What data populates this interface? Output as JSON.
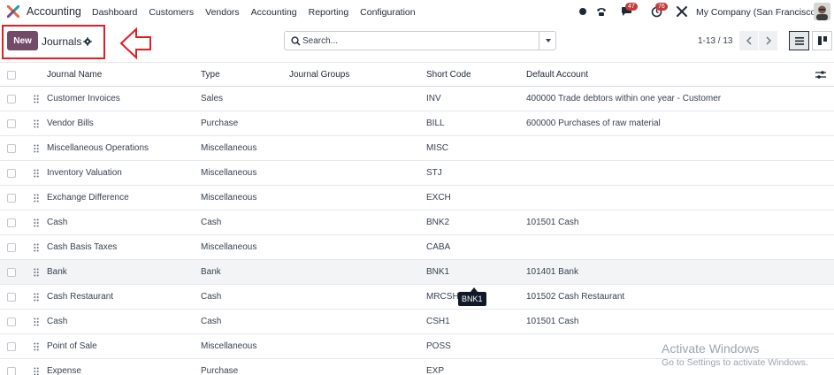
{
  "navbar": {
    "app_name": "Accounting",
    "menu": [
      "Dashboard",
      "Customers",
      "Vendors",
      "Accounting",
      "Reporting",
      "Configuration"
    ],
    "messages_count": "47",
    "activities_count": "76",
    "company": "My Company (San Francisco)"
  },
  "control_panel": {
    "new_label": "New",
    "title": "Journals",
    "search_placeholder": "Search...",
    "pager": "1-13 / 13"
  },
  "table": {
    "columns": [
      "Journal Name",
      "Type",
      "Journal Groups",
      "Short Code",
      "Default Account"
    ],
    "rows": [
      {
        "name": "Customer Invoices",
        "type": "Sales",
        "groups": "",
        "code": "INV",
        "account": "400000 Trade debtors within one year - Customer"
      },
      {
        "name": "Vendor Bills",
        "type": "Purchase",
        "groups": "",
        "code": "BILL",
        "account": "600000 Purchases of raw material"
      },
      {
        "name": "Miscellaneous Operations",
        "type": "Miscellaneous",
        "groups": "",
        "code": "MISC",
        "account": ""
      },
      {
        "name": "Inventory Valuation",
        "type": "Miscellaneous",
        "groups": "",
        "code": "STJ",
        "account": ""
      },
      {
        "name": "Exchange Difference",
        "type": "Miscellaneous",
        "groups": "",
        "code": "EXCH",
        "account": ""
      },
      {
        "name": "Cash",
        "type": "Cash",
        "groups": "",
        "code": "BNK2",
        "account": "101501 Cash"
      },
      {
        "name": "Cash Basis Taxes",
        "type": "Miscellaneous",
        "groups": "",
        "code": "CABA",
        "account": ""
      },
      {
        "name": "Bank",
        "type": "Bank",
        "groups": "",
        "code": "BNK1",
        "account": "101401 Bank"
      },
      {
        "name": "Cash Restaurant",
        "type": "Cash",
        "groups": "",
        "code": "MRCSH",
        "account": "101502 Cash Restaurant"
      },
      {
        "name": "Cash",
        "type": "Cash",
        "groups": "",
        "code": "CSH1",
        "account": "101501 Cash"
      },
      {
        "name": "Point of Sale",
        "type": "Miscellaneous",
        "groups": "",
        "code": "POSS",
        "account": ""
      },
      {
        "name": "Expense",
        "type": "Purchase",
        "groups": "",
        "code": "EXP",
        "account": ""
      }
    ]
  },
  "tooltip": "BNK1",
  "watermark": {
    "title": "Activate Windows",
    "subtitle": "Go to Settings to activate Windows."
  },
  "colors": {
    "brand": "#714b67",
    "highlight": "#e11d28",
    "badge": "#c53a3a"
  },
  "icons": [
    "app-logo-icon",
    "status-dot-icon",
    "phone-icon",
    "chat-icon",
    "clock-icon",
    "tools-icon",
    "gear-icon",
    "search-icon",
    "caret-down-icon",
    "chevron-left-icon",
    "chevron-right-icon",
    "list-view-icon",
    "kanban-view-icon",
    "drag-handle-icon",
    "optional-columns-icon",
    "arrow-left-icon"
  ]
}
